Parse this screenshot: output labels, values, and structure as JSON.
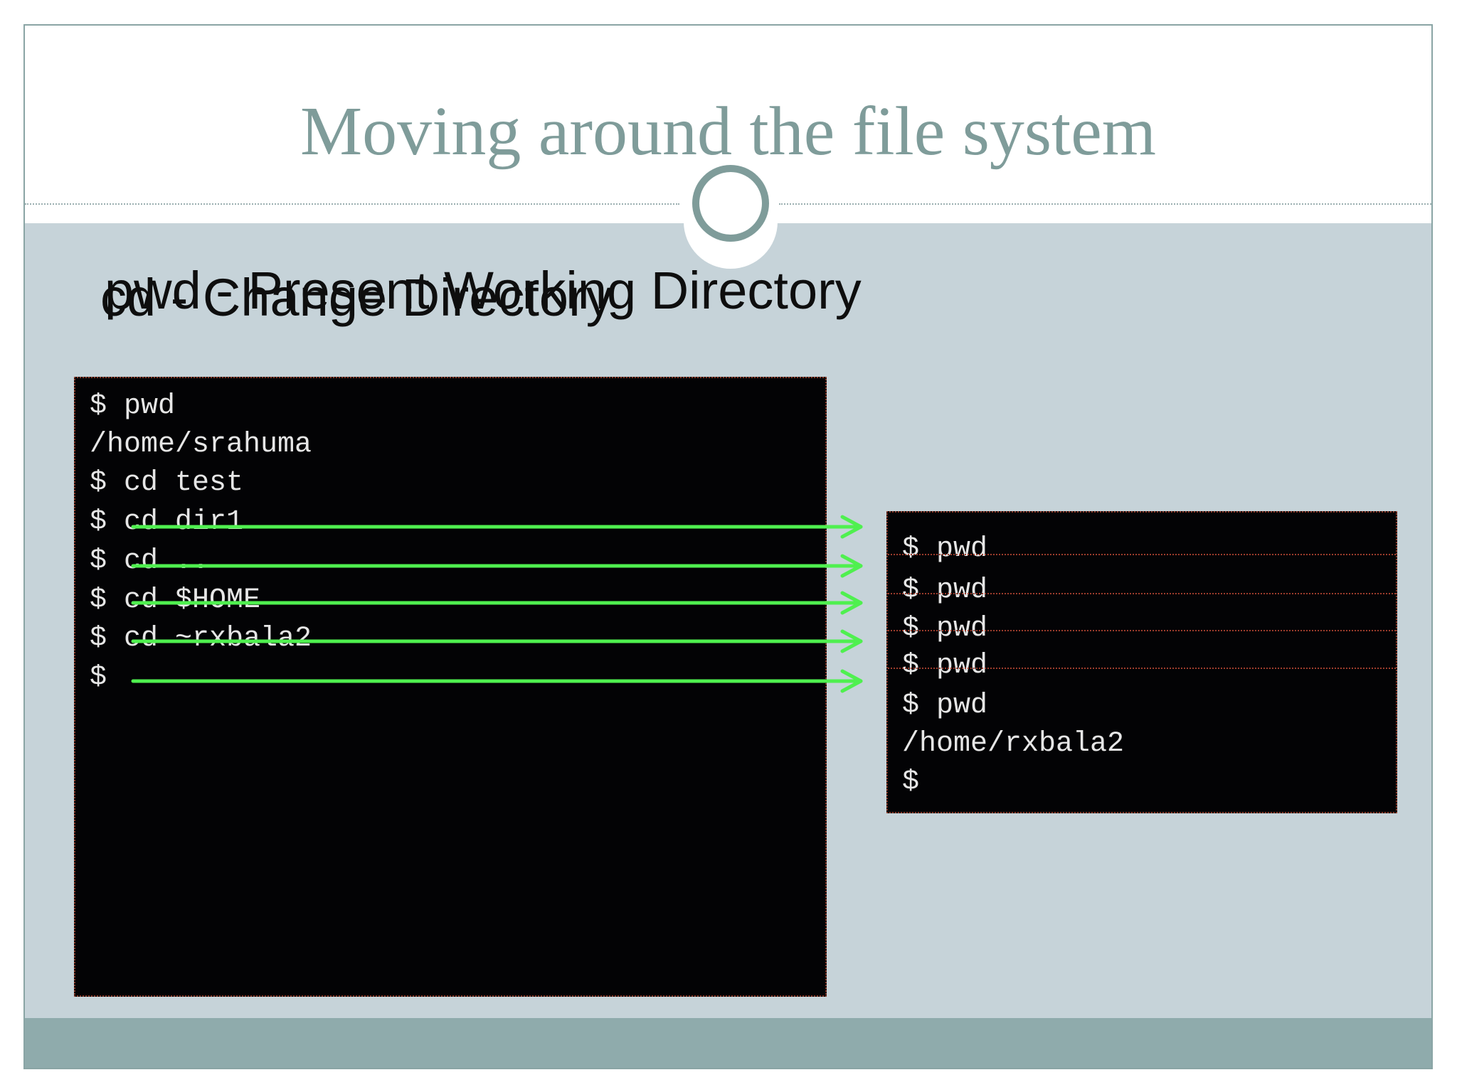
{
  "slide": {
    "title": "Moving around the file system",
    "subtitle_pwd": "pwd - Present Working Directory",
    "subtitle_cd": "cd - Change Directory"
  },
  "left_terminal": {
    "lines": [
      "$ pwd",
      "/home/srahuma",
      "$ cd test",
      "$ cd dir1",
      "$ cd ..",
      "$ cd $HOME",
      "$ cd ~rxbala2",
      "$"
    ]
  },
  "right_terminal": {
    "stacked_prompts": [
      "$ pwd",
      "$ pwd",
      "$ pwd",
      "$ pwd"
    ],
    "final_lines": [
      "$ pwd",
      "/home/rxbala2",
      "$"
    ]
  },
  "colors": {
    "title": "#7f9c9a",
    "body_background": "#c6d3d9",
    "footer": "#8fabac",
    "terminal_background": "#030305",
    "arrow": "#4ff04f"
  }
}
